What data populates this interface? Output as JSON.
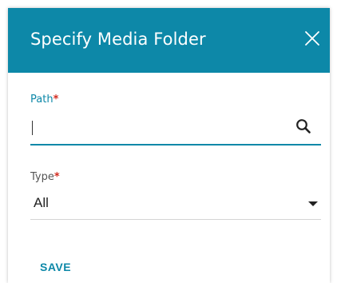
{
  "dialog": {
    "title": "Specify Media Folder",
    "close_icon": "close-icon"
  },
  "path_field": {
    "label": "Path",
    "required_mark": "*",
    "value": "",
    "placeholder": "",
    "search_icon": "search-icon"
  },
  "type_field": {
    "label": "Type",
    "required_mark": "*",
    "selected": "All",
    "dropdown_icon": "caret-down-icon"
  },
  "actions": {
    "save_label": "SAVE"
  },
  "colors": {
    "accent": "#0d88a8",
    "required": "#d22b1f"
  }
}
